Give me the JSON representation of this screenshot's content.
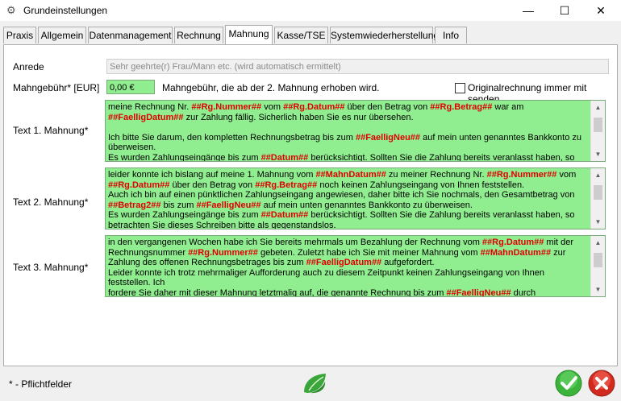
{
  "window": {
    "title": "Grundeinstellungen",
    "icon": "gear-icon",
    "controls": {
      "minimize": "—",
      "maximize": "☐",
      "close": "✕"
    }
  },
  "tabs": [
    {
      "label": "Praxis"
    },
    {
      "label": "Allgemein"
    },
    {
      "label": "Datenmanagement"
    },
    {
      "label": "Rechnung"
    },
    {
      "label": "Mahnung"
    },
    {
      "label": "Kasse/TSE"
    },
    {
      "label": "Systemwiederherstellung"
    },
    {
      "label": "Info"
    }
  ],
  "active_tab": "Mahnung",
  "form": {
    "anrede": {
      "label": "Anrede",
      "value": "Sehr geehrte(r) Frau/Mann etc. (wird automatisch ermittelt)"
    },
    "mahngebuehr": {
      "label": "Mahngebühr* [EUR]",
      "value": "0,00 €",
      "hint": "Mahngebühr, die ab der 2. Mahnung erhoben wird."
    },
    "originalrechnung": {
      "label": "Originalrechnung immer mit senden",
      "checked": false
    },
    "text1": {
      "label": "Text 1. Mahnung*",
      "segments": [
        {
          "t": "meine Rechnung Nr. "
        },
        {
          "p": "##Rg.Nummer##"
        },
        {
          "t": " vom "
        },
        {
          "p": "##Rg.Datum##"
        },
        {
          "t": " über den Betrag von "
        },
        {
          "p": "##Rg.Betrag##"
        },
        {
          "t": " war am\n"
        },
        {
          "p": "##FaelligDatum##"
        },
        {
          "t": " zur Zahlung fällig. Sicherlich haben Sie es nur übersehen.\n\nIch bitte Sie darum, den kompletten Rechnungsbetrag bis zum "
        },
        {
          "p": "##FaelligNeu##"
        },
        {
          "t": " auf mein unten genanntes Bankkonto zu\nüberweisen.\nEs wurden Zahlungseingänge bis zum "
        },
        {
          "p": "##Datum##"
        },
        {
          "t": " berücksichtigt. Sollten Sie die Zahlung bereits veranlasst haben, so"
        }
      ]
    },
    "text2": {
      "label": "Text 2. Mahnung*",
      "segments": [
        {
          "t": "leider konnte ich bislang auf meine 1. Mahnung vom "
        },
        {
          "p": "##MahnDatum##"
        },
        {
          "t": " zu meiner Rechnung Nr. "
        },
        {
          "p": "##Rg.Nummer##"
        },
        {
          "t": " vom\n"
        },
        {
          "p": "##Rg.Datum##"
        },
        {
          "t": " über den Betrag von "
        },
        {
          "p": "##Rg.Betrag##"
        },
        {
          "t": " noch keinen Zahlungseingang von Ihnen feststellen.\nAuch ich bin auf einen pünktlichen Zahlungseingang angewiesen, daher bitte ich Sie nochmals, den Gesamtbetrag von\n"
        },
        {
          "p": "##Betrag2##"
        },
        {
          "t": " bis zum "
        },
        {
          "p": "##FaelligNeu##"
        },
        {
          "t": " auf mein unten genanntes Bankkonto zu überweisen.\nEs wurden Zahlungseingänge bis zum "
        },
        {
          "p": "##Datum##"
        },
        {
          "t": " berücksichtigt. Sollten Sie die Zahlung bereits veranlasst haben, so\nbetrachten Sie dieses Schreiben bitte als gegenstandslos."
        }
      ]
    },
    "text3": {
      "label": "Text 3. Mahnung*",
      "segments": [
        {
          "t": "in den vergangenen Wochen habe ich Sie bereits mehrmals um Bezahlung der Rechnung vom "
        },
        {
          "p": "##Rg.Datum##"
        },
        {
          "t": " mit der\nRechnungsnummer "
        },
        {
          "p": "##Rg.Nummer##"
        },
        {
          "t": " gebeten. Zuletzt habe ich Sie mit meiner Mahnung vom "
        },
        {
          "p": "##MahnDatum##"
        },
        {
          "t": " zur\nZahlung des offenen Rechnungsbetrages bis zum "
        },
        {
          "p": "##FaelligDatum##"
        },
        {
          "t": " aufgefordert.\nLeider konnte ich trotz mehrmaliger Aufforderung auch zu diesem Zeitpunkt keinen Zahlungseingang von Ihnen feststellen. Ich\nfordere Sie daher mit dieser Mahnung letztmalig auf, die genannte Rechnung bis zum "
        },
        {
          "p": "##FaelligNeu##"
        },
        {
          "t": " durch Überweisung\nauf mein unten angegebenes Konto zu begleichen. Sollte auch bis zu diesem Zeitpunkt keine Zahlung von Ihnen erfolgen,"
        }
      ]
    }
  },
  "footer": {
    "required_note": "* - Pflichtfelder",
    "center_icon": "leaf-icon",
    "ok_icon": "checkmark-icon",
    "cancel_icon": "cancel-x-icon"
  },
  "colors": {
    "field_green": "#90ee90",
    "placeholder_red": "#e00000"
  }
}
